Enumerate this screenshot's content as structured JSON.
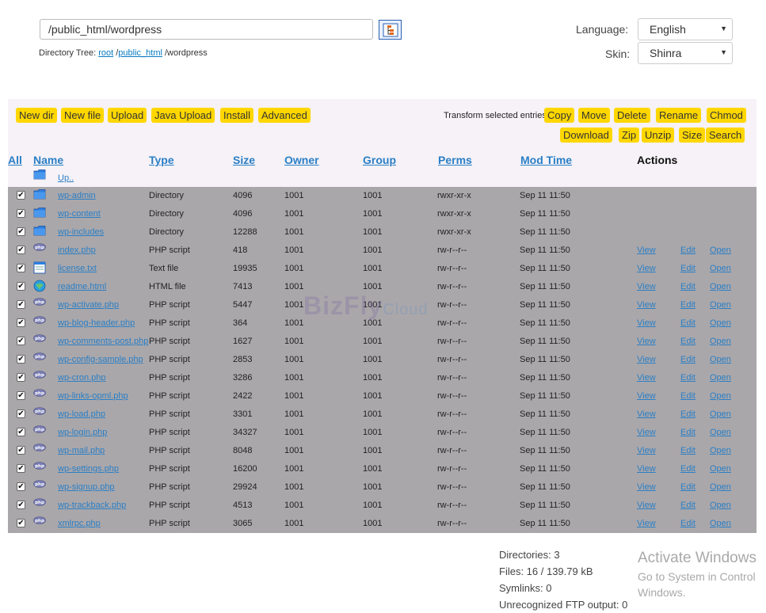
{
  "path_bar": {
    "value": "/public_html/wordpress"
  },
  "dir_tree": {
    "label": "Directory Tree:",
    "crumbs": [
      "root",
      "public_html"
    ],
    "current": "/wordpress"
  },
  "language": {
    "label": "Language:",
    "selected": "English"
  },
  "skin": {
    "label": "Skin:",
    "selected": "Shinra"
  },
  "toolbar": [
    "New dir",
    "New file",
    "Upload",
    "Java Upload",
    "Install",
    "Advanced"
  ],
  "transform": {
    "label": "Transform selected entries:",
    "buttons": [
      "Copy",
      "Move",
      "Delete",
      "Rename",
      "Chmod",
      "Download",
      "Zip",
      "Unzip",
      "Size",
      "Search"
    ]
  },
  "columns": {
    "all": "All",
    "name": "Name",
    "type": "Type",
    "size": "Size",
    "owner": "Owner",
    "group": "Group",
    "perms": "Perms",
    "mtime": "Mod Time",
    "actions": "Actions"
  },
  "up_link": "Up..",
  "action_labels": {
    "view": "View",
    "edit": "Edit",
    "open": "Open"
  },
  "files": [
    {
      "name": "wp-admin",
      "type": "Directory",
      "size": "4096",
      "owner": "1001",
      "group": "1001",
      "perms": "rwxr-xr-x",
      "mtime": "Sep 11 11:50",
      "icon": "folder-icon"
    },
    {
      "name": "wp-content",
      "type": "Directory",
      "size": "4096",
      "owner": "1001",
      "group": "1001",
      "perms": "rwxr-xr-x",
      "mtime": "Sep 11 11:50",
      "icon": "folder-icon"
    },
    {
      "name": "wp-includes",
      "type": "Directory",
      "size": "12288",
      "owner": "1001",
      "group": "1001",
      "perms": "rwxr-xr-x",
      "mtime": "Sep 11 11:50",
      "icon": "folder-icon"
    },
    {
      "name": "index.php",
      "type": "PHP script",
      "size": "418",
      "owner": "1001",
      "group": "1001",
      "perms": "rw-r--r--",
      "mtime": "Sep 11 11:50",
      "icon": "php-icon"
    },
    {
      "name": "license.txt",
      "type": "Text file",
      "size": "19935",
      "owner": "1001",
      "group": "1001",
      "perms": "rw-r--r--",
      "mtime": "Sep 11 11:50",
      "icon": "text-file-icon"
    },
    {
      "name": "readme.html",
      "type": "HTML file",
      "size": "7413",
      "owner": "1001",
      "group": "1001",
      "perms": "rw-r--r--",
      "mtime": "Sep 11 11:50",
      "icon": "html-file-icon"
    },
    {
      "name": "wp-activate.php",
      "type": "PHP script",
      "size": "5447",
      "owner": "1001",
      "group": "1001",
      "perms": "rw-r--r--",
      "mtime": "Sep 11 11:50",
      "icon": "php-icon"
    },
    {
      "name": "wp-blog-header.php",
      "type": "PHP script",
      "size": "364",
      "owner": "1001",
      "group": "1001",
      "perms": "rw-r--r--",
      "mtime": "Sep 11 11:50",
      "icon": "php-icon"
    },
    {
      "name": "wp-comments-post.php",
      "type": "PHP script",
      "size": "1627",
      "owner": "1001",
      "group": "1001",
      "perms": "rw-r--r--",
      "mtime": "Sep 11 11:50",
      "icon": "php-icon"
    },
    {
      "name": "wp-config-sample.php",
      "type": "PHP script",
      "size": "2853",
      "owner": "1001",
      "group": "1001",
      "perms": "rw-r--r--",
      "mtime": "Sep 11 11:50",
      "icon": "php-icon"
    },
    {
      "name": "wp-cron.php",
      "type": "PHP script",
      "size": "3286",
      "owner": "1001",
      "group": "1001",
      "perms": "rw-r--r--",
      "mtime": "Sep 11 11:50",
      "icon": "php-icon"
    },
    {
      "name": "wp-links-opml.php",
      "type": "PHP script",
      "size": "2422",
      "owner": "1001",
      "group": "1001",
      "perms": "rw-r--r--",
      "mtime": "Sep 11 11:50",
      "icon": "php-icon"
    },
    {
      "name": "wp-load.php",
      "type": "PHP script",
      "size": "3301",
      "owner": "1001",
      "group": "1001",
      "perms": "rw-r--r--",
      "mtime": "Sep 11 11:50",
      "icon": "php-icon"
    },
    {
      "name": "wp-login.php",
      "type": "PHP script",
      "size": "34327",
      "owner": "1001",
      "group": "1001",
      "perms": "rw-r--r--",
      "mtime": "Sep 11 11:50",
      "icon": "php-icon"
    },
    {
      "name": "wp-mail.php",
      "type": "PHP script",
      "size": "8048",
      "owner": "1001",
      "group": "1001",
      "perms": "rw-r--r--",
      "mtime": "Sep 11 11:50",
      "icon": "php-icon"
    },
    {
      "name": "wp-settings.php",
      "type": "PHP script",
      "size": "16200",
      "owner": "1001",
      "group": "1001",
      "perms": "rw-r--r--",
      "mtime": "Sep 11 11:50",
      "icon": "php-icon"
    },
    {
      "name": "wp-signup.php",
      "type": "PHP script",
      "size": "29924",
      "owner": "1001",
      "group": "1001",
      "perms": "rw-r--r--",
      "mtime": "Sep 11 11:50",
      "icon": "php-icon"
    },
    {
      "name": "wp-trackback.php",
      "type": "PHP script",
      "size": "4513",
      "owner": "1001",
      "group": "1001",
      "perms": "rw-r--r--",
      "mtime": "Sep 11 11:50",
      "icon": "php-icon"
    },
    {
      "name": "xmlrpc.php",
      "type": "PHP script",
      "size": "3065",
      "owner": "1001",
      "group": "1001",
      "perms": "rw-r--r--",
      "mtime": "Sep 11 11:50",
      "icon": "php-icon"
    }
  ],
  "stats": [
    "Directories: 3",
    "Files: 16 / 139.79 kB",
    "Symlinks: 0",
    "Unrecognized FTP output: 0"
  ],
  "watermark": {
    "main": "BizFly",
    "sub": "Cloud"
  },
  "activation_notice": {
    "title": "Activate Windows",
    "line1": "Go to System in Control",
    "line2": "Windows."
  },
  "colors": {
    "accent_button": "#ffd700",
    "link": "#2a7fc6",
    "rows_bg": "#aaa7aa",
    "panel_bg": "#f6f2f7"
  }
}
